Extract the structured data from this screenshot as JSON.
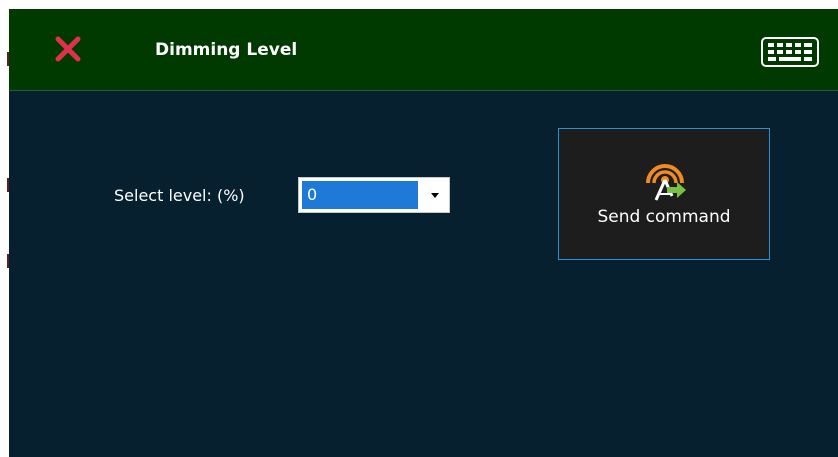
{
  "header": {
    "title": "Dimming Level",
    "close_icon": "close-icon",
    "keyboard_icon": "keyboard-icon"
  },
  "form": {
    "level_label": "Select level: (%)",
    "level_value": "0",
    "dropdown_icon": "chevron-down-icon"
  },
  "send_button": {
    "label": "Send command",
    "icon": "antenna-send-icon"
  },
  "colors": {
    "header_bg": "#003a00",
    "panel_bg": "#06202f",
    "close_red": "#e0304e",
    "combo_selection": "#1e7ad6",
    "button_border": "#2e8fd6",
    "icon_orange": "#f08a24",
    "icon_green": "#79c142"
  }
}
